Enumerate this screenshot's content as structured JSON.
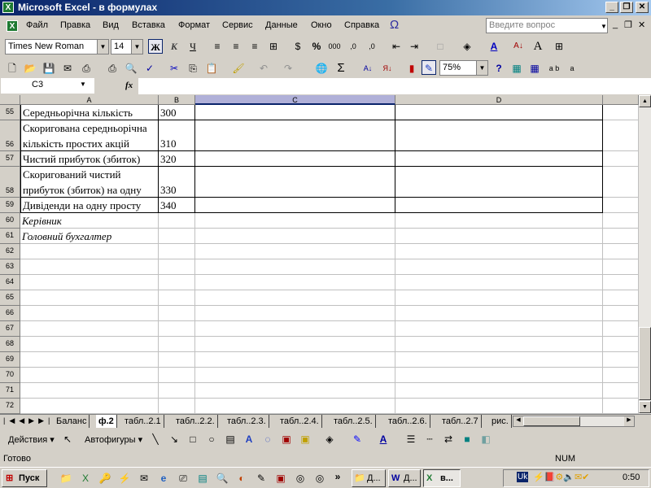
{
  "window": {
    "title": "Microsoft Excel - в формулах",
    "minimize": "_",
    "restore": "❐",
    "close": "✕"
  },
  "menu": [
    "Файл",
    "Правка",
    "Вид",
    "Вставка",
    "Формат",
    "Сервис",
    "Данные",
    "Окно",
    "Справка"
  ],
  "ask_placeholder": "Введите вопрос",
  "format_toolbar": {
    "font": "Times New Roman",
    "size": "14",
    "bold": "Ж",
    "italic": "К",
    "underline": "Ч",
    "percent": "%",
    "thousands": "000"
  },
  "std_toolbar": {
    "zoom": "75%",
    "sum": "Σ"
  },
  "formula_bar": {
    "name_box": "C3",
    "fx": "fx",
    "value": ""
  },
  "columns": [
    "A",
    "B",
    "C",
    "D"
  ],
  "rows": [
    {
      "n": "55",
      "a": "Середньорічна кількість",
      "b": "300"
    },
    {
      "n": "56",
      "a": "Скоригована середньорічна кількість простих акцій",
      "a1": "Скоригована середньорічна",
      "a2": "кількість простих акцій",
      "b": "310"
    },
    {
      "n": "57",
      "a": "Чистий прибуток (збиток)",
      "b": "320"
    },
    {
      "n": "58",
      "a1": "Скоригований чистий",
      "a2": "прибуток (збиток) на одну",
      "b": "330"
    },
    {
      "n": "59",
      "a": "Дивіденди на одну просту",
      "b": "340"
    },
    {
      "n": "60",
      "a": "Керівник"
    },
    {
      "n": "61",
      "a": "Головний бухгалтер"
    },
    {
      "n": "62"
    },
    {
      "n": "63"
    },
    {
      "n": "64"
    },
    {
      "n": "65"
    },
    {
      "n": "66"
    },
    {
      "n": "67"
    },
    {
      "n": "68"
    },
    {
      "n": "69"
    },
    {
      "n": "70"
    },
    {
      "n": "71"
    },
    {
      "n": "72"
    }
  ],
  "sheet_tabs": [
    "Баланс",
    "ф.2",
    "табл..2.1",
    "табл..2.2.",
    "табл..2.3.",
    "табл..2.4.",
    "табл..2.5.",
    "табл..2.6.",
    "табл..2.7",
    "рис."
  ],
  "active_tab": "ф.2",
  "drawing": {
    "actions": "Действия",
    "autoshapes": "Автофигуры"
  },
  "status": {
    "ready": "Готово",
    "num": "NUM"
  },
  "taskbar": {
    "start": "Пуск",
    "buttons": [
      "Д...",
      "Д...",
      "в..."
    ],
    "clock": "0:50",
    "lang": "Uk"
  }
}
